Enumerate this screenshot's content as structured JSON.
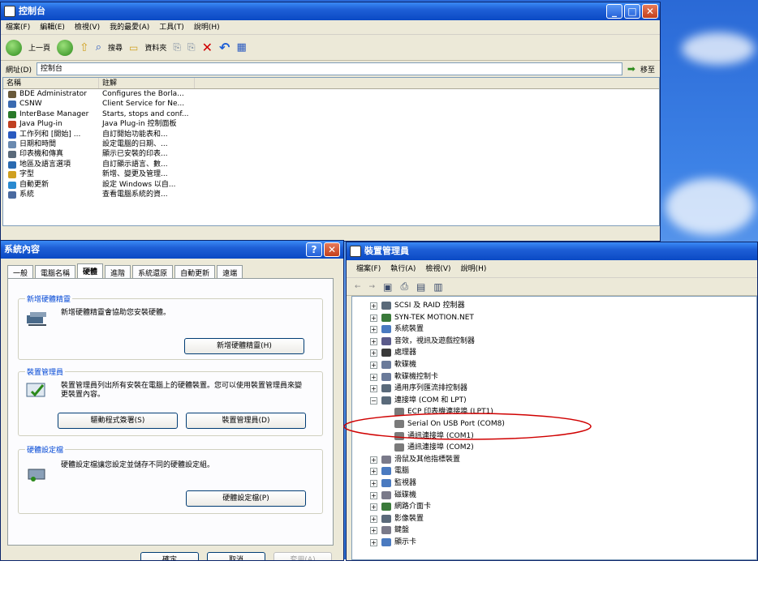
{
  "colors": {
    "accent": "#d00000",
    "title_blue": "#0a49c4"
  },
  "cp": {
    "title": "控制台",
    "menu": [
      "檔案(F)",
      "編輯(E)",
      "檢視(V)",
      "我的最愛(A)",
      "工具(T)",
      "說明(H)"
    ],
    "toolbar": {
      "back": "上一頁",
      "search": "搜尋",
      "folders": "資料夾"
    },
    "address_label": "網址(D)",
    "address_value": "控制台",
    "go": "移至",
    "columns": [
      "名稱",
      "註解"
    ],
    "items": [
      {
        "name": "BDE Administrator",
        "note": "Configures the Borla...",
        "color": "#6a5a3a"
      },
      {
        "name": "CSNW",
        "note": "Client Service for Ne...",
        "color": "#3a6ab0"
      },
      {
        "name": "InterBase Manager",
        "note": "Starts, stops and conf...",
        "color": "#2a7a2a"
      },
      {
        "name": "Java Plug-in",
        "note": "Java Plug-in 控制面板",
        "color": "#c04020"
      },
      {
        "name": "工作列和 [開始] ...",
        "note": "自訂開始功能表和...",
        "color": "#2a5ac0"
      },
      {
        "name": "日期和時間",
        "note": "設定電腦的日期、...",
        "color": "#6a8ab0"
      },
      {
        "name": "印表機和傳真",
        "note": "顯示已安裝的印表...",
        "color": "#5a6a7a"
      },
      {
        "name": "地區及語言選項",
        "note": "自訂顯示語言、數...",
        "color": "#2a6ab0"
      },
      {
        "name": "字型",
        "note": "新增、變更及管理...",
        "color": "#d0a020"
      },
      {
        "name": "自動更新",
        "note": "設定 Windows 以自...",
        "color": "#2a8ad0"
      },
      {
        "name": "系統",
        "note": "查看電腦系統的資...",
        "color": "#4a6aa0"
      }
    ]
  },
  "sys": {
    "title": "系統內容",
    "help": "?",
    "tabs": [
      "一般",
      "電腦名稱",
      "硬體",
      "進階",
      "系統還原",
      "自動更新",
      "遠端"
    ],
    "selected_tab": "硬體",
    "g1": {
      "title": "新增硬體精靈",
      "desc": "新增硬體精靈會協助您安裝硬體。",
      "btn": "新增硬體精靈(H)"
    },
    "g2": {
      "title": "裝置管理員",
      "desc": "裝置管理員列出所有安裝在電腦上的硬體裝置。您可以使用裝置管理員來變更裝置內容。",
      "btn1": "驅動程式簽署(S)",
      "btn2": "裝置管理員(D)"
    },
    "g3": {
      "title": "硬體設定檔",
      "desc": "硬體設定檔讓您設定並儲存不同的硬體設定組。",
      "btn": "硬體設定檔(P)"
    },
    "ok": "確定",
    "cancel": "取消",
    "apply": "套用(A)"
  },
  "dm": {
    "title": "裝置管理員",
    "menu": [
      "檔案(F)",
      "執行(A)",
      "檢視(V)",
      "說明(H)"
    ],
    "nodes": [
      {
        "label": "SCSI 及 RAID 控制器",
        "child": false,
        "expanded": false,
        "icon": "#5a6a7a"
      },
      {
        "label": "SYN-TEK MOTION.NET",
        "child": false,
        "expanded": false,
        "icon": "#3a7a3a"
      },
      {
        "label": "系統裝置",
        "child": false,
        "expanded": false,
        "icon": "#4a7ac0"
      },
      {
        "label": "音效，視訊及遊戲控制器",
        "child": false,
        "expanded": false,
        "icon": "#5a5a8a"
      },
      {
        "label": "處理器",
        "child": false,
        "expanded": false,
        "icon": "#3a3a3a"
      },
      {
        "label": "軟碟機",
        "child": false,
        "expanded": false,
        "icon": "#6a7a9a"
      },
      {
        "label": "軟碟機控制卡",
        "child": false,
        "expanded": false,
        "icon": "#6a7a9a"
      },
      {
        "label": "通用序列匯流排控制器",
        "child": false,
        "expanded": false,
        "icon": "#5a6a7a"
      },
      {
        "label": "連接埠 (COM 和 LPT)",
        "child": false,
        "expanded": true,
        "icon": "#5a6a7a"
      },
      {
        "label": "ECP 印表機連接埠 (LPT1)",
        "child": true,
        "icon": "#7a7a7a"
      },
      {
        "label": "Serial On USB Port (COM8)",
        "child": true,
        "icon": "#7a7a7a"
      },
      {
        "label": "通訊連接埠 (COM1)",
        "child": true,
        "icon": "#7a7a7a"
      },
      {
        "label": "通訊連接埠 (COM2)",
        "child": true,
        "icon": "#7a7a7a"
      },
      {
        "label": "滑鼠及其他指標裝置",
        "child": false,
        "expanded": false,
        "icon": "#7a7a8a"
      },
      {
        "label": "電腦",
        "child": false,
        "expanded": false,
        "icon": "#4a7ac0"
      },
      {
        "label": "監視器",
        "child": false,
        "expanded": false,
        "icon": "#4a7ac0"
      },
      {
        "label": "磁碟機",
        "child": false,
        "expanded": false,
        "icon": "#7a7a8a"
      },
      {
        "label": "網路介面卡",
        "child": false,
        "expanded": false,
        "icon": "#3a7a3a"
      },
      {
        "label": "影像裝置",
        "child": false,
        "expanded": false,
        "icon": "#5a6a7a"
      },
      {
        "label": "鍵盤",
        "child": false,
        "expanded": false,
        "icon": "#7a7a8a"
      },
      {
        "label": "顯示卡",
        "child": false,
        "expanded": false,
        "icon": "#4a7ac0"
      }
    ]
  }
}
